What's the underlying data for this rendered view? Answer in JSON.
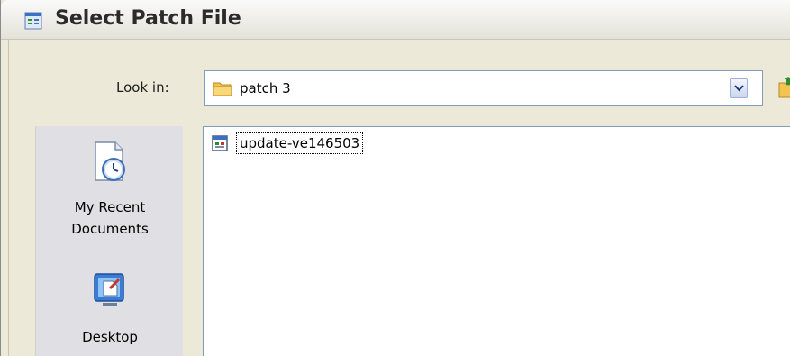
{
  "window": {
    "title": "Select Patch File",
    "title_icon": "patch-file-icon"
  },
  "look_in": {
    "label": "Look in:",
    "value": "patch 3",
    "value_icon": "folder-icon"
  },
  "places": [
    {
      "label": "My Recent Documents",
      "icon": "recent-documents-icon"
    },
    {
      "label": "Desktop",
      "icon": "desktop-icon"
    }
  ],
  "files": [
    {
      "name": "update-ve146503",
      "icon": "patch-file-icon",
      "selected": true
    }
  ],
  "colors": {
    "window_bg": "#ece9d8",
    "places_bg": "#e0dfe3",
    "combo_border": "#7f9db9",
    "folder": "#f2c451"
  }
}
